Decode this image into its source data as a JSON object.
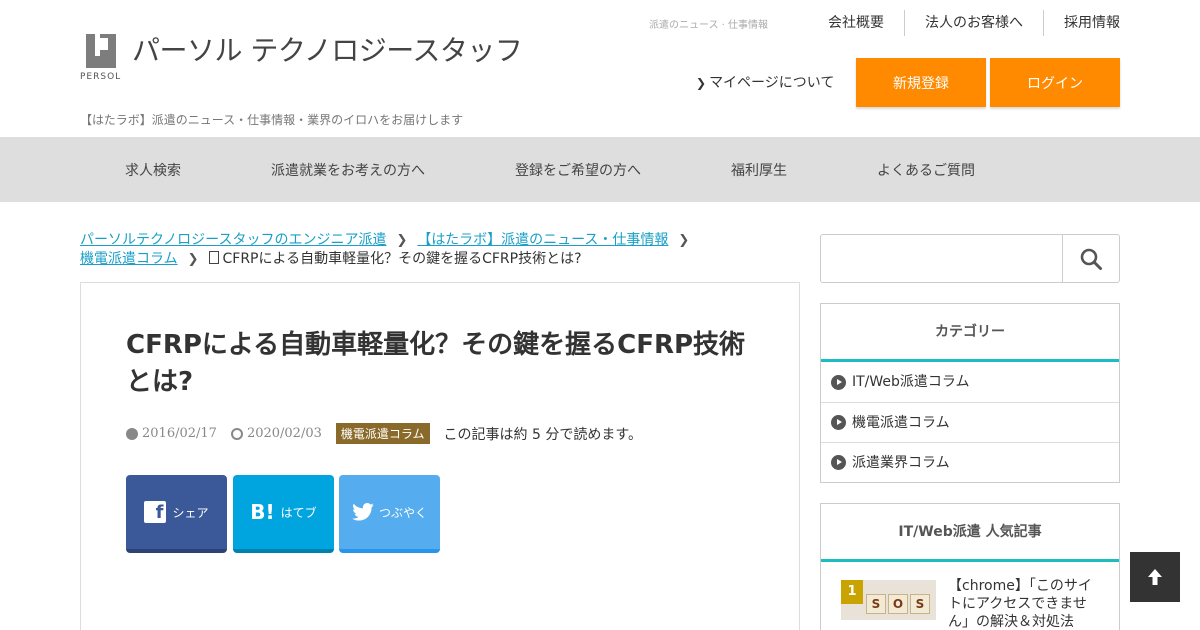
{
  "header": {
    "logo_word": "PERSOL",
    "logo_name": "パーソル テクノロジースタッフ",
    "tagline": "【はたラボ】派遣のニュース・仕事情報・業界のイロハをお届けします",
    "top_small": "派遣のニュース · 仕事情報",
    "top_links": [
      "会社概要",
      "法人のお客様へ",
      "採用情報"
    ],
    "mypage": "マイページについて",
    "register": "新規登録",
    "login": "ログイン"
  },
  "nav": [
    "求人検索",
    "派遣就業をお考えの方へ",
    "登録をご希望の方へ",
    "福利厚生",
    "よくあるご質問"
  ],
  "breadcrumb": {
    "items": [
      "パーソルテクノロジースタッフのエンジニア派遣",
      "【はたラボ】派遣のニュース・仕事情報",
      "機電派遣コラム"
    ],
    "current": "CFRPによる自動車軽量化？その鍵を握るCFRP技術とは?"
  },
  "article": {
    "title": "CFRPによる自動車軽量化？その鍵を握るCFRP技術とは?",
    "published": "2016/02/17",
    "updated": "2020/02/03",
    "category": "機電派遣コラム",
    "read_time": "この記事は約 5 分で読めます。",
    "share": {
      "facebook": "シェア",
      "hatena": "はてブ",
      "twitter": "つぶやく"
    }
  },
  "sidebar": {
    "categories_title": "カテゴリー",
    "categories": [
      "IT/Web派遣コラム",
      "機電派遣コラム",
      "派遣業界コラム"
    ],
    "popular_title": "IT/Web派遣 人気記事",
    "popular": [
      {
        "rank": "1",
        "title": "【chrome】「このサイトにアクセスできません」の解決＆対処法"
      }
    ],
    "thumb_letters": [
      "S",
      "O",
      "S"
    ]
  },
  "colors": {
    "accent": "#ff8a00",
    "teal": "#1bbdc0",
    "link": "#1aa0c8",
    "badge": "#8a6a2a"
  },
  "icons": [
    "search-icon",
    "clock-icon",
    "sync-icon",
    "document-icon",
    "chevron-right-icon",
    "arrow-up-icon",
    "facebook-icon",
    "hatena-icon",
    "twitter-icon"
  ]
}
